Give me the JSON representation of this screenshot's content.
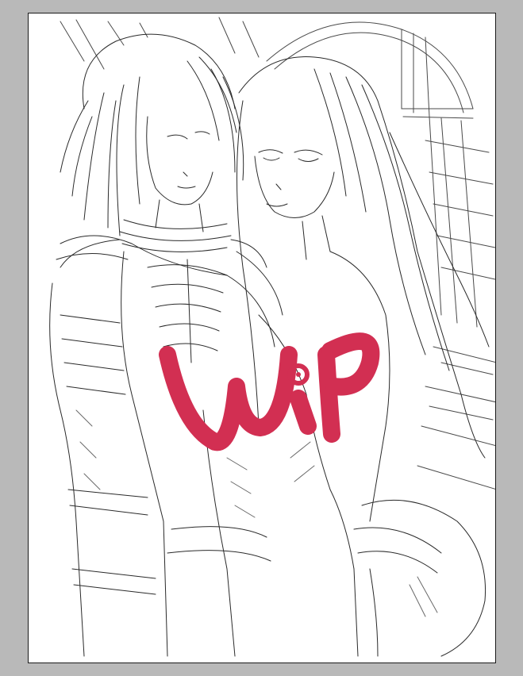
{
  "canvas": {
    "background": "#ffffff",
    "border_color": "#1a1a1a"
  },
  "workspace": {
    "background": "#b9b9b9"
  },
  "artwork": {
    "style": "pencil line-art sketch",
    "line_color": "#2a2a2a"
  },
  "watermark": {
    "text": "WIP",
    "color": "#d22f52"
  }
}
